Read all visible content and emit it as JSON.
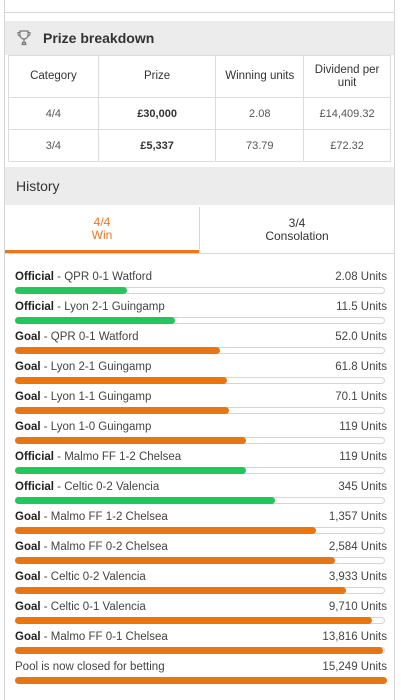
{
  "prize_breakdown": {
    "title": "Prize breakdown",
    "icon": "trophy-icon",
    "columns": [
      "Category",
      "Prize",
      "Winning units",
      "Dividend per unit"
    ],
    "rows": [
      {
        "category": "4/4",
        "prize": "£30,000",
        "units": "2.08",
        "dividend": "£14,409.32"
      },
      {
        "category": "3/4",
        "prize": "£5,337",
        "units": "73.79",
        "dividend": "£72.32"
      }
    ]
  },
  "history": {
    "title": "History",
    "tabs": [
      {
        "line1": "4/4",
        "line2": "Win",
        "active": true
      },
      {
        "line1": "3/4",
        "line2": "Consolation",
        "active": false
      }
    ],
    "items": [
      {
        "kind": "Official",
        "text": " - QPR 0-1 Watford",
        "units": "2.08 Units",
        "fill": 0.3,
        "color": "green"
      },
      {
        "kind": "Official",
        "text": " - Lyon 2-1 Guingamp",
        "units": "11.5 Units",
        "fill": 0.43,
        "color": "green"
      },
      {
        "kind": "Goal",
        "text": " - QPR 0-1 Watford",
        "units": "52.0 Units",
        "fill": 0.55,
        "color": "orange"
      },
      {
        "kind": "Goal",
        "text": " - Lyon 2-1 Guingamp",
        "units": "61.8 Units",
        "fill": 0.57,
        "color": "orange"
      },
      {
        "kind": "Goal",
        "text": " - Lyon 1-1 Guingamp",
        "units": "70.1 Units",
        "fill": 0.575,
        "color": "orange"
      },
      {
        "kind": "Goal",
        "text": " - Lyon 1-0 Guingamp",
        "units": "119 Units",
        "fill": 0.62,
        "color": "orange"
      },
      {
        "kind": "Official",
        "text": " - Malmo FF 1-2 Chelsea",
        "units": "119 Units",
        "fill": 0.62,
        "color": "green"
      },
      {
        "kind": "Official",
        "text": " - Celtic 0-2 Valencia",
        "units": "345 Units",
        "fill": 0.7,
        "color": "green"
      },
      {
        "kind": "Goal",
        "text": " - Malmo FF 1-2 Chelsea",
        "units": "1,357 Units",
        "fill": 0.81,
        "color": "orange"
      },
      {
        "kind": "Goal",
        "text": " - Malmo FF 0-2 Chelsea",
        "units": "2,584 Units",
        "fill": 0.86,
        "color": "orange"
      },
      {
        "kind": "Goal",
        "text": " - Celtic 0-2 Valencia",
        "units": "3,933 Units",
        "fill": 0.89,
        "color": "orange"
      },
      {
        "kind": "Goal",
        "text": " - Celtic 0-1 Valencia",
        "units": "9,710 Units",
        "fill": 0.96,
        "color": "orange"
      },
      {
        "kind": "Goal",
        "text": " - Malmo FF 0-1 Chelsea",
        "units": "13,816 Units",
        "fill": 0.99,
        "color": "orange"
      },
      {
        "kind": "",
        "text": "Pool is now closed for betting",
        "units": "15,249 Units",
        "fill": 1.0,
        "color": "orange"
      }
    ]
  },
  "colors": {
    "green": "#22c55e",
    "orange": "#e87511",
    "accent": "#e87722"
  }
}
